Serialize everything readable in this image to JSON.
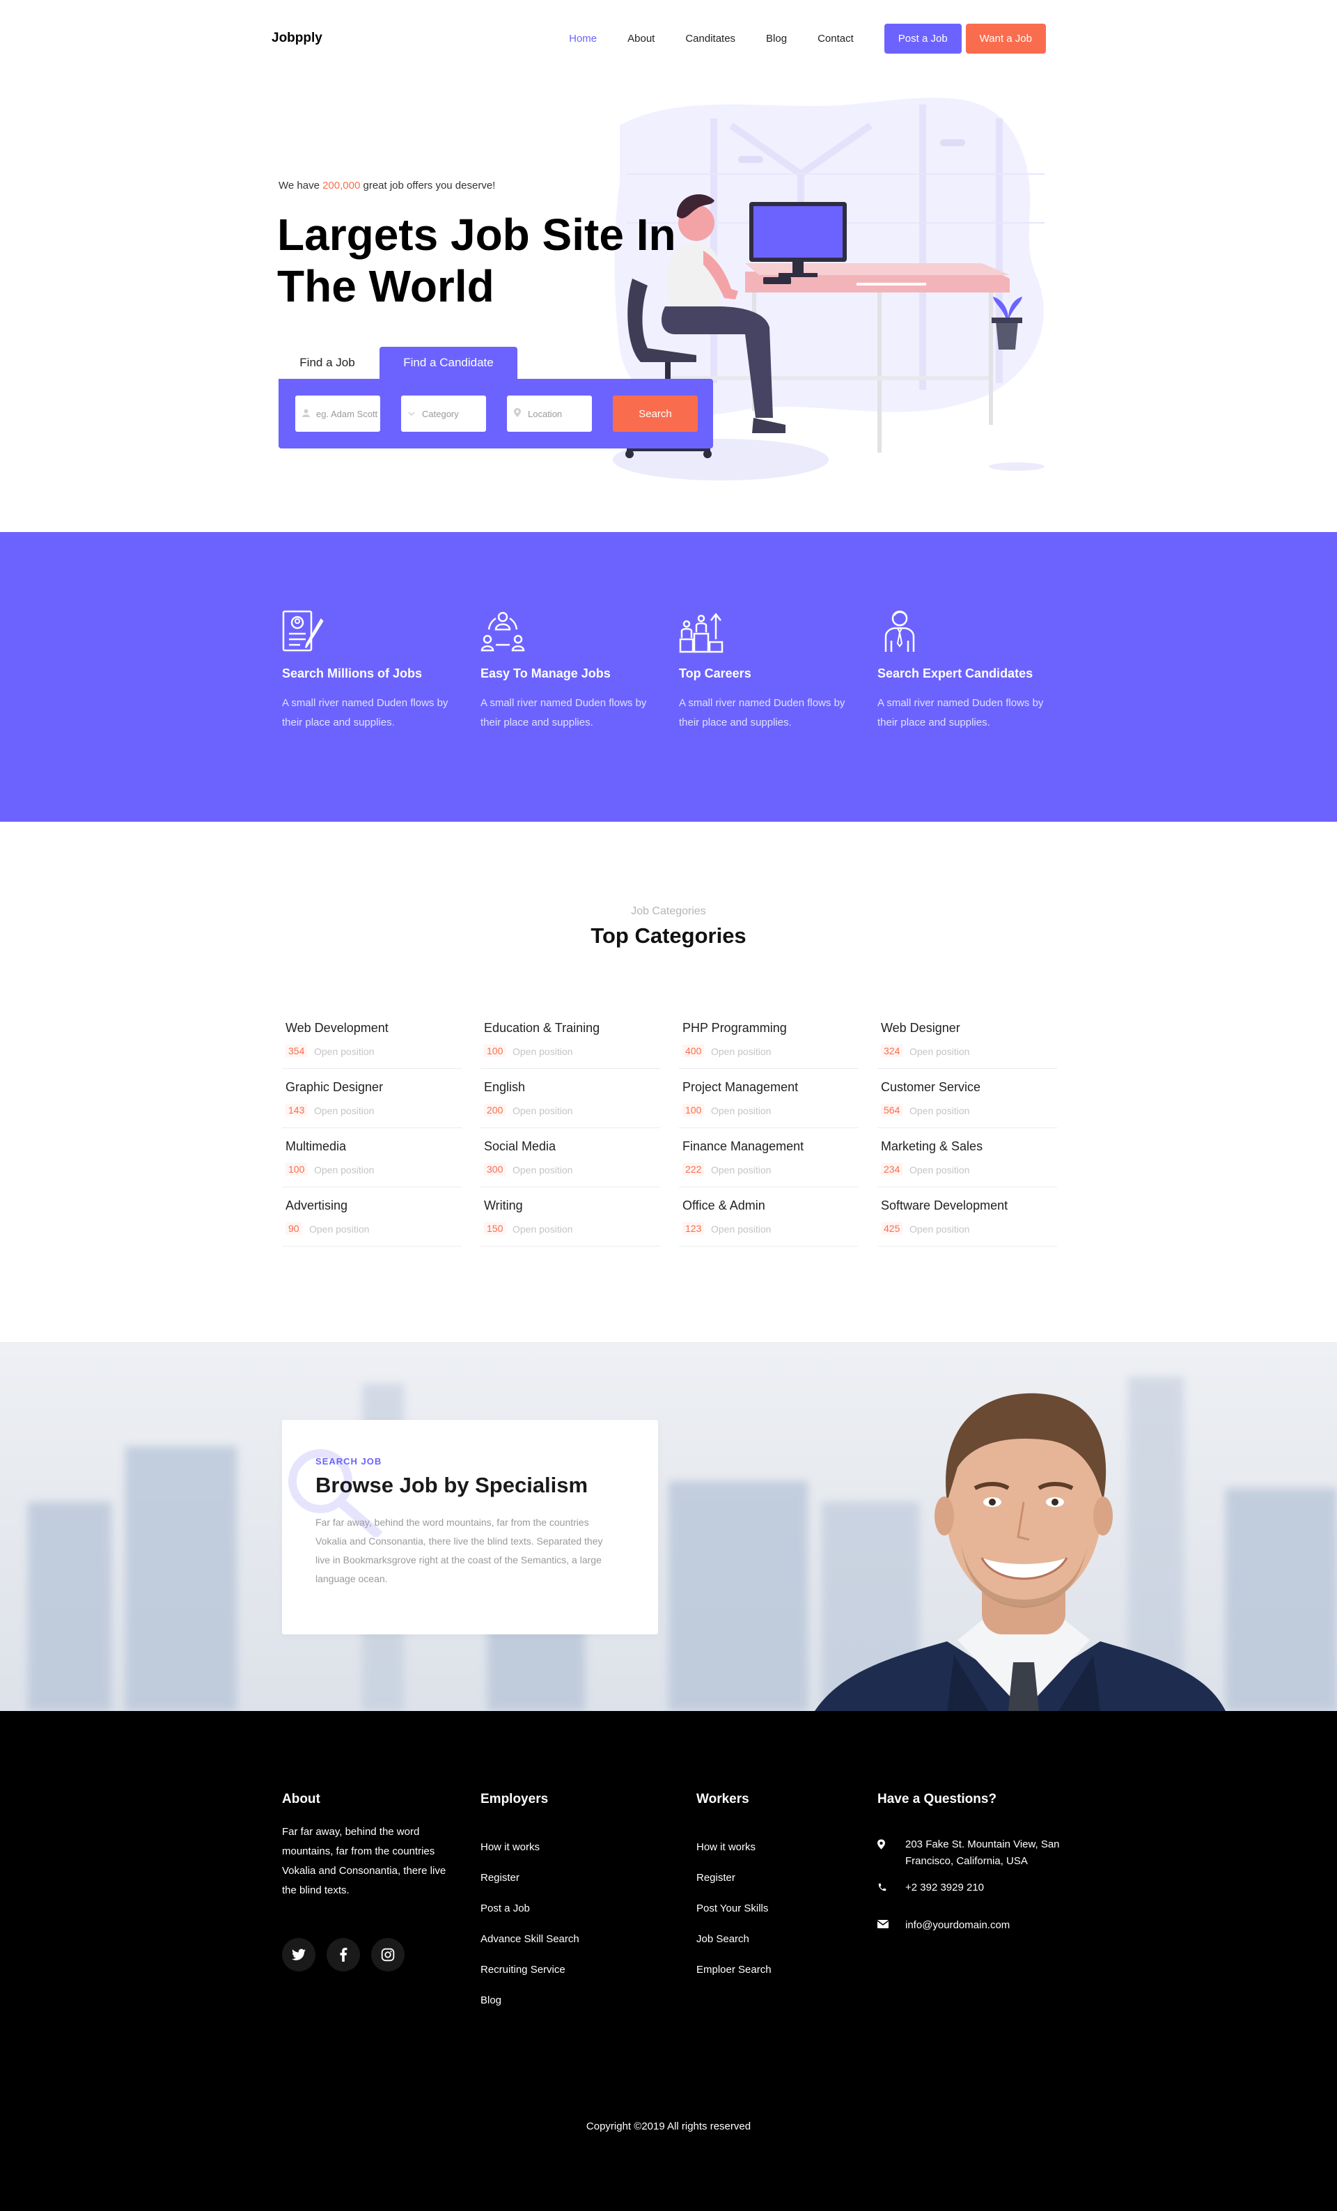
{
  "nav": {
    "brand": "Jobpply",
    "items": [
      "Home",
      "About",
      "Canditates",
      "Blog",
      "Contact"
    ],
    "active": "Home",
    "post_job": "Post a Job",
    "want_job": "Want a Job"
  },
  "hero": {
    "tagline_pre": "We have ",
    "tagline_count": "200,000",
    "tagline_post": " great job offers you deserve!",
    "title": "Largets Job Site In The World",
    "tab_find_job": "Find a Job",
    "tab_find_candidate": "Find a Candidate",
    "search": {
      "name_placeholder": "eg. Adam Scott",
      "category_placeholder": "Category",
      "location_placeholder": "Location",
      "button": "Search"
    }
  },
  "features": [
    {
      "title": "Search Millions of Jobs",
      "text": "A small river named Duden flows by their place and supplies.",
      "icon": "resume-icon"
    },
    {
      "title": "Easy To Manage Jobs",
      "text": "A small river named Duden flows by their place and supplies.",
      "icon": "team-network-icon"
    },
    {
      "title": "Top Careers",
      "text": "A small river named Duden flows by their place and supplies.",
      "icon": "career-podium-icon"
    },
    {
      "title": "Search Expert Candidates",
      "text": "A small river named Duden flows by their place and supplies.",
      "icon": "businessman-icon"
    }
  ],
  "categories": {
    "subtitle": "Job Categories",
    "title": "Top Categories",
    "open_label": "Open position",
    "items": [
      {
        "name": "Web Development",
        "count": "354"
      },
      {
        "name": "Education & Training",
        "count": "100"
      },
      {
        "name": "PHP Programming",
        "count": "400"
      },
      {
        "name": "Web Designer",
        "count": "324"
      },
      {
        "name": "Graphic Designer",
        "count": "143"
      },
      {
        "name": "English",
        "count": "200"
      },
      {
        "name": "Project Management",
        "count": "100"
      },
      {
        "name": "Customer Service",
        "count": "564"
      },
      {
        "name": "Multimedia",
        "count": "100"
      },
      {
        "name": "Social Media",
        "count": "300"
      },
      {
        "name": "Finance Management",
        "count": "222"
      },
      {
        "name": "Marketing & Sales",
        "count": "234"
      },
      {
        "name": "Advertising",
        "count": "90"
      },
      {
        "name": "Writing",
        "count": "150"
      },
      {
        "name": "Office & Admin",
        "count": "123"
      },
      {
        "name": "Software Development",
        "count": "425"
      }
    ]
  },
  "specialism": {
    "label": "SEARCH JOB",
    "title": "Browse Job by Specialism",
    "text": "Far far away, behind the word mountains, far from the countries Vokalia and Consonantia, there live the blind texts. Separated they live in Bookmarksgrove right at the coast of the Semantics, a large language ocean."
  },
  "footer": {
    "about_title": "About",
    "about_text": "Far far away, behind the word mountains, far from the countries Vokalia and Consonantia, there live the blind texts.",
    "social": [
      "twitter-icon",
      "facebook-icon",
      "instagram-icon"
    ],
    "employers_title": "Employers",
    "employers": [
      "How it works",
      "Register",
      "Post a Job",
      "Advance Skill Search",
      "Recruiting Service",
      "Blog"
    ],
    "workers_title": "Workers",
    "workers": [
      "How it works",
      "Register",
      "Post Your Skills",
      "Job Search",
      "Emploer Search"
    ],
    "questions_title": "Have a Questions?",
    "address": "203 Fake St. Mountain View, San Francisco, California, USA",
    "phone": "+2 392 3929 210",
    "email": "info@yourdomain.com",
    "copyright": "Copyright ©2019 All rights reserved"
  },
  "colors": {
    "accent": "#6c63ff",
    "highlight": "#f96d4e",
    "footer_bg": "#000000"
  }
}
